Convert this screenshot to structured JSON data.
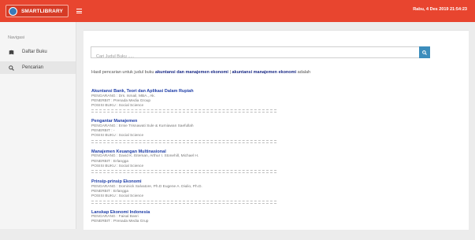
{
  "header": {
    "brand": "SMARTLIBRARY",
    "datetime": "Rabu, 4 Des 2019 21:54:23"
  },
  "sidebar": {
    "section_label": "Navigasi",
    "items": [
      {
        "label": "Daftar Buku",
        "icon": "book-icon"
      },
      {
        "label": "Pencarian",
        "icon": "search-icon"
      }
    ]
  },
  "search": {
    "placeholder": "Cari Judul Buku .....",
    "value": ""
  },
  "results_summary": {
    "prefix": "Hasil pencarian untuk judul buku",
    "query": "akuntansi dan manajemen ekonomi",
    "separator": "|",
    "query_repeat": "akuntansi manajemen ekonomi",
    "suffix": "adalah"
  },
  "books": [
    {
      "title": "Akuntansi Bank, Teori dan Aplikasi Dalam Rupiah",
      "pengarang": "PENGARANG : Drs. Ismail, MBA., Ak.",
      "penerbit": "PENERBIT : Prenada Media Group",
      "posisi": "POSISI BUKU : Social Science"
    },
    {
      "title": "Pengantar Manajemen",
      "pengarang": "PENGARANG : Ernie Trisnawati Sule & Kurniawan Saefullah",
      "penerbit": "PENERBIT : -",
      "posisi": "POSISI BUKU : Social Science"
    },
    {
      "title": "Manajemen Keuangan Multinasional",
      "pengarang": "PENGARANG : David K. Eiteman, Arthur I. Stonehill, Michael H.",
      "penerbit": "PENERBIT : Erlangga",
      "posisi": "POSISI BUKU : Social Science"
    },
    {
      "title": "Prinsip-prinsip Ekonomi",
      "pengarang": "PENGARANG : Dominick Salvatore, Ph.D Eugene A. Diulio, Ph.D.",
      "penerbit": "PENERBIT : Erlangga",
      "posisi": "POSISI BUKU : Social Science"
    },
    {
      "title": "Lanskap Ekonomi Indonesia",
      "pengarang": "PENGARANG : Faisal Basri",
      "penerbit": "PENERBIT : Prenada Media Grup",
      "posisi": ""
    }
  ],
  "colors": {
    "topbar": "#e8452f",
    "accent": "#3c8dbc",
    "book_title": "#1f3ea8"
  }
}
